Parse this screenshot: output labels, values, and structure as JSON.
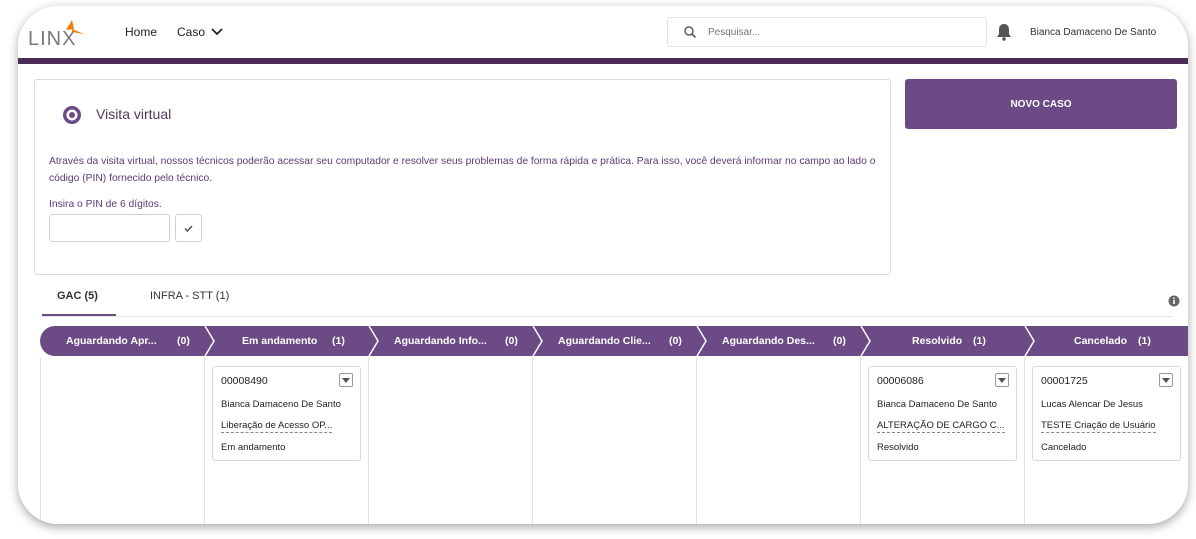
{
  "header": {
    "logo_text": "LINX",
    "nav": {
      "home": "Home",
      "caso": "Caso"
    },
    "search_placeholder": "Pesquisar...",
    "user_name": "Bianca Damaceno De Santo",
    "accent_color": "#4b2a55"
  },
  "virtual_visit": {
    "title": "Visita virtual",
    "description": "Através da visita virtual, nossos técnicos poderão acessar seu computador e resolver seus problemas de forma rápida e prática. Para isso, você deverá informar no campo ao lado o código (PIN) fornecido pelo técnico.",
    "pin_label": "Insira o PIN de 6 dígitos.",
    "pin_value": ""
  },
  "novo_caso_label": "NOVO CASO",
  "tabs": [
    {
      "label": "GAC (5)",
      "active": true
    },
    {
      "label": "INFRA - STT (1)",
      "active": false
    }
  ],
  "stages": [
    {
      "label": "Aguardando Apr...",
      "count": "(0)"
    },
    {
      "label": "Em andamento",
      "count": "(1)"
    },
    {
      "label": "Aguardando Info...",
      "count": "(0)"
    },
    {
      "label": "Aguardando Clie...",
      "count": "(0)"
    },
    {
      "label": "Aguardando Des...",
      "count": "(0)"
    },
    {
      "label": "Resolvido",
      "count": "(1)"
    },
    {
      "label": "Cancelado",
      "count": "(1)"
    }
  ],
  "cases": [
    {
      "number": "00008490",
      "owner": "Bianca Damaceno De Santo",
      "subject": "Liberação de Acesso OP...",
      "status": "Em andamento"
    },
    {
      "number": "00006086",
      "owner": "Bianca Damaceno De Santo",
      "subject": "ALTERAÇÃO DE CARGO C...",
      "status": "Resolvido"
    },
    {
      "number": "00001725",
      "owner": "Lucas Alencar De Jesus",
      "subject": "TESTE Criação de Usuário",
      "status": "Cancelado"
    }
  ],
  "colors": {
    "stage_bar": "#6b4a85",
    "button": "#6b4a85"
  }
}
